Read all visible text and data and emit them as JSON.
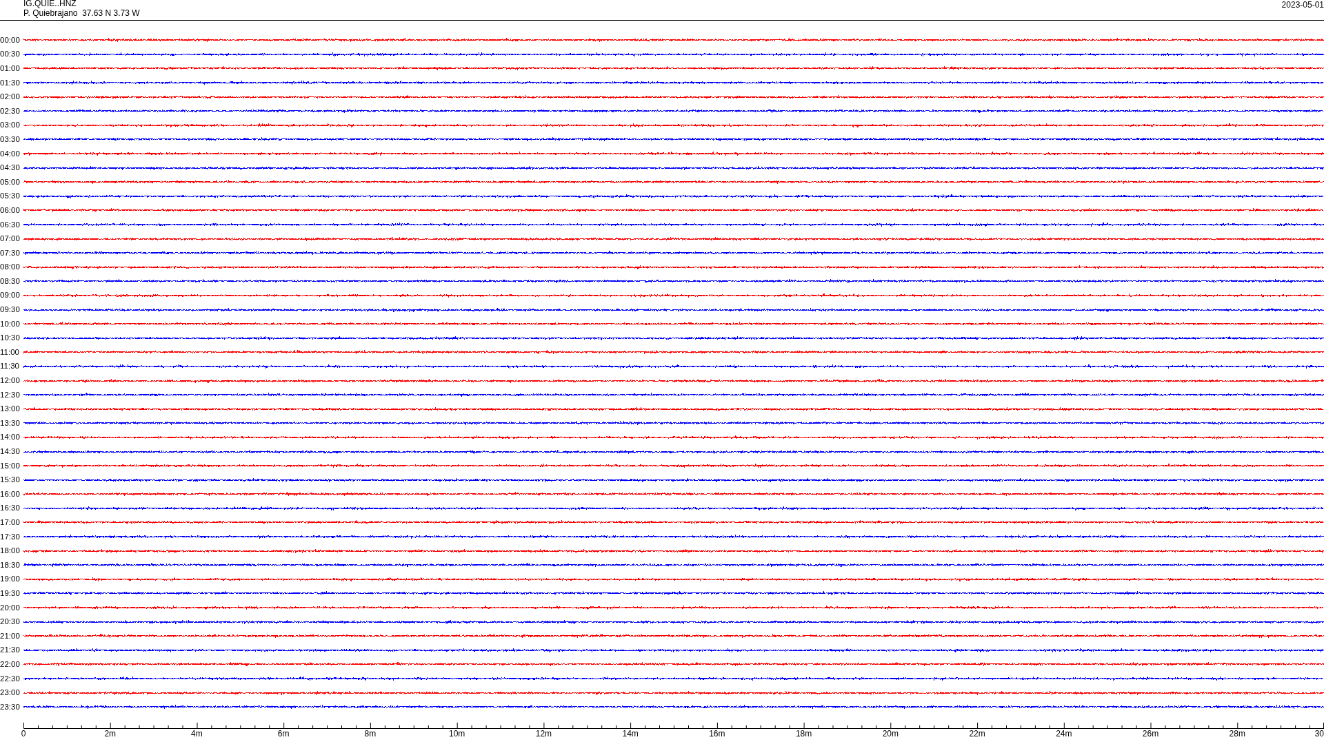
{
  "header": {
    "station": "IG.QUIE..HNZ",
    "location": "P. Quiebrajano  37.63 N 3.73 W",
    "date": "2023-05-01"
  },
  "traces": [
    {
      "time": "00:00",
      "color": "#ff0000"
    },
    {
      "time": "00:30",
      "color": "#0000ff"
    },
    {
      "time": "01:00",
      "color": "#ff0000"
    },
    {
      "time": "01:30",
      "color": "#0000ff"
    },
    {
      "time": "02:00",
      "color": "#ff0000"
    },
    {
      "time": "02:30",
      "color": "#0000ff"
    },
    {
      "time": "03:00",
      "color": "#ff0000"
    },
    {
      "time": "03:30",
      "color": "#0000ff"
    },
    {
      "time": "04:00",
      "color": "#ff0000"
    },
    {
      "time": "04:30",
      "color": "#0000ff"
    },
    {
      "time": "05:00",
      "color": "#ff0000"
    },
    {
      "time": "05:30",
      "color": "#0000ff"
    },
    {
      "time": "06:00",
      "color": "#ff0000"
    },
    {
      "time": "06:30",
      "color": "#0000ff"
    },
    {
      "time": "07:00",
      "color": "#ff0000"
    },
    {
      "time": "07:30",
      "color": "#0000ff"
    },
    {
      "time": "08:00",
      "color": "#ff0000"
    },
    {
      "time": "08:30",
      "color": "#0000ff"
    },
    {
      "time": "09:00",
      "color": "#ff0000"
    },
    {
      "time": "09:30",
      "color": "#0000ff"
    },
    {
      "time": "10:00",
      "color": "#ff0000"
    },
    {
      "time": "10:30",
      "color": "#0000ff"
    },
    {
      "time": "11:00",
      "color": "#ff0000"
    },
    {
      "time": "11:30",
      "color": "#0000ff"
    },
    {
      "time": "12:00",
      "color": "#ff0000"
    },
    {
      "time": "12:30",
      "color": "#0000ff"
    },
    {
      "time": "13:00",
      "color": "#ff0000"
    },
    {
      "time": "13:30",
      "color": "#0000ff"
    },
    {
      "time": "14:00",
      "color": "#ff0000"
    },
    {
      "time": "14:30",
      "color": "#0000ff"
    },
    {
      "time": "15:00",
      "color": "#ff0000"
    },
    {
      "time": "15:30",
      "color": "#0000ff"
    },
    {
      "time": "16:00",
      "color": "#ff0000"
    },
    {
      "time": "16:30",
      "color": "#0000ff"
    },
    {
      "time": "17:00",
      "color": "#ff0000"
    },
    {
      "time": "17:30",
      "color": "#0000ff"
    },
    {
      "time": "18:00",
      "color": "#ff0000"
    },
    {
      "time": "18:30",
      "color": "#0000ff"
    },
    {
      "time": "19:00",
      "color": "#ff0000"
    },
    {
      "time": "19:30",
      "color": "#0000ff"
    },
    {
      "time": "20:00",
      "color": "#ff0000"
    },
    {
      "time": "20:30",
      "color": "#0000ff"
    },
    {
      "time": "21:00",
      "color": "#ff0000"
    },
    {
      "time": "21:30",
      "color": "#0000ff"
    },
    {
      "time": "22:00",
      "color": "#ff0000"
    },
    {
      "time": "22:30",
      "color": "#0000ff"
    },
    {
      "time": "23:00",
      "color": "#ff0000"
    },
    {
      "time": "23:30",
      "color": "#0000ff"
    }
  ],
  "axis": {
    "labels": [
      "0",
      "2m",
      "4m",
      "6m",
      "8m",
      "10m",
      "12m",
      "14m",
      "16m",
      "18m",
      "20m",
      "22m",
      "24m",
      "26m",
      "28m",
      "30"
    ]
  }
}
